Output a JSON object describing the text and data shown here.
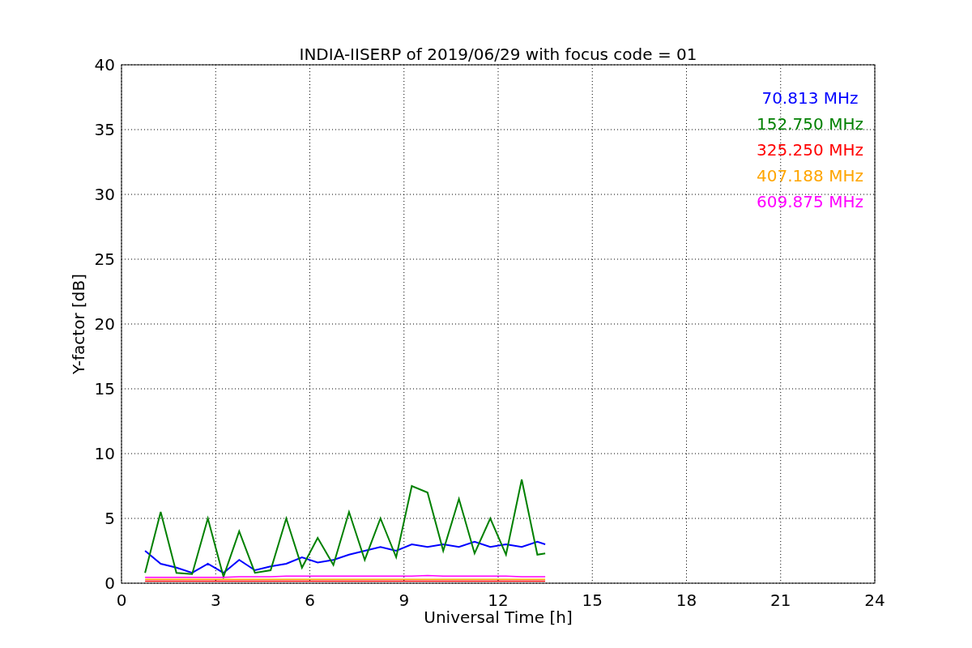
{
  "chart_data": {
    "type": "line",
    "title": "INDIA-IISERP of 2019/06/29 with focus code = 01",
    "xlabel": "Universal Time [h]",
    "ylabel": "Y-factor [dB]",
    "x": [
      0.75,
      1.25,
      1.75,
      2.25,
      2.75,
      3.25,
      3.75,
      4.25,
      4.75,
      5.25,
      5.75,
      6.25,
      6.75,
      7.25,
      7.75,
      8.25,
      8.75,
      9.25,
      9.75,
      10.25,
      10.75,
      11.25,
      11.75,
      12.25,
      12.75,
      13.25,
      13.5
    ],
    "series": [
      {
        "name": "70.813 MHz",
        "color": "#0000ff",
        "values": [
          2.5,
          1.5,
          1.2,
          0.8,
          1.5,
          0.8,
          1.8,
          1.0,
          1.3,
          1.5,
          2.0,
          1.6,
          1.8,
          2.2,
          2.5,
          2.8,
          2.5,
          3.0,
          2.8,
          3.0,
          2.8,
          3.2,
          2.8,
          3.0,
          2.8,
          3.2,
          3.0
        ]
      },
      {
        "name": "152.750 MHz",
        "color": "#008000",
        "values": [
          0.8,
          5.5,
          0.8,
          0.7,
          5.0,
          0.5,
          4.0,
          0.8,
          1.0,
          5.0,
          1.2,
          3.5,
          1.4,
          5.5,
          1.8,
          5.0,
          2.0,
          7.5,
          7.0,
          2.5,
          6.5,
          2.3,
          5.0,
          2.2,
          8.0,
          2.2,
          2.3
        ]
      },
      {
        "name": "325.250 MHz",
        "color": "#ff0000",
        "values": [
          0.15,
          0.15,
          0.15,
          0.15,
          0.15,
          0.15,
          0.15,
          0.15,
          0.15,
          0.15,
          0.15,
          0.15,
          0.15,
          0.15,
          0.15,
          0.15,
          0.15,
          0.15,
          0.15,
          0.15,
          0.15,
          0.15,
          0.15,
          0.15,
          0.15,
          0.15,
          0.15
        ]
      },
      {
        "name": "407.188 MHz",
        "color": "#ffa500",
        "values": [
          0.3,
          0.3,
          0.3,
          0.3,
          0.3,
          0.3,
          0.3,
          0.3,
          0.3,
          0.3,
          0.3,
          0.3,
          0.3,
          0.3,
          0.3,
          0.3,
          0.3,
          0.3,
          0.3,
          0.3,
          0.3,
          0.3,
          0.3,
          0.3,
          0.3,
          0.3,
          0.3
        ]
      },
      {
        "name": "609.875 MHz",
        "color": "#ff00ff",
        "values": [
          0.45,
          0.45,
          0.45,
          0.45,
          0.45,
          0.45,
          0.5,
          0.5,
          0.5,
          0.55,
          0.55,
          0.55,
          0.55,
          0.55,
          0.55,
          0.55,
          0.55,
          0.55,
          0.6,
          0.55,
          0.55,
          0.55,
          0.55,
          0.55,
          0.5,
          0.5,
          0.5
        ]
      }
    ],
    "grid": true,
    "xlim": [
      0,
      24
    ],
    "ylim": [
      0,
      40
    ],
    "xticks": [
      0,
      3,
      6,
      9,
      12,
      15,
      18,
      21,
      24
    ],
    "yticks": [
      0,
      5,
      10,
      15,
      20,
      25,
      30,
      35,
      40
    ]
  }
}
